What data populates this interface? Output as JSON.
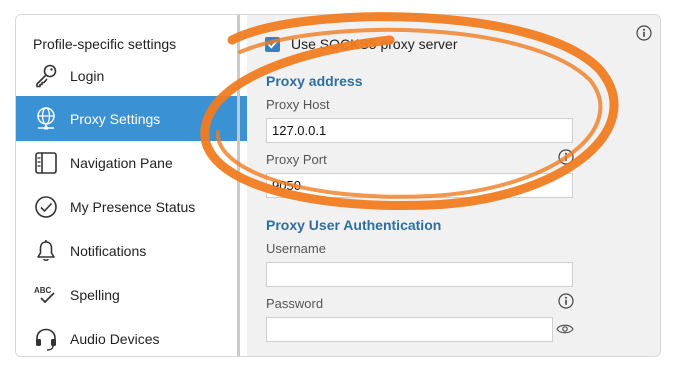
{
  "sidebar": {
    "title": "Profile-specific settings",
    "items": [
      {
        "label": "Login",
        "icon": "key-icon"
      },
      {
        "label": "Proxy Settings",
        "icon": "globe-network-icon",
        "active": true
      },
      {
        "label": "Navigation Pane",
        "icon": "panel-icon"
      },
      {
        "label": "My Presence Status",
        "icon": "check-circle-icon"
      },
      {
        "label": "Notifications",
        "icon": "bell-icon"
      },
      {
        "label": "Spelling",
        "icon": "spellcheck-icon"
      },
      {
        "label": "Audio Devices",
        "icon": "headset-icon"
      }
    ]
  },
  "proxy": {
    "use_socks5_label": "Use SOCKS5 proxy server",
    "use_socks5_checked": true,
    "address_heading": "Proxy address",
    "host_label": "Proxy Host",
    "host_value": "127.0.0.1",
    "port_label": "Proxy Port",
    "port_value": "9050",
    "auth_heading": "Proxy User Authentication",
    "username_label": "Username",
    "username_value": "",
    "password_label": "Password",
    "password_value": ""
  },
  "colors": {
    "accent": "#3a92d4",
    "heading": "#2f6f9f",
    "highlight_swirl": "#f07c22"
  }
}
